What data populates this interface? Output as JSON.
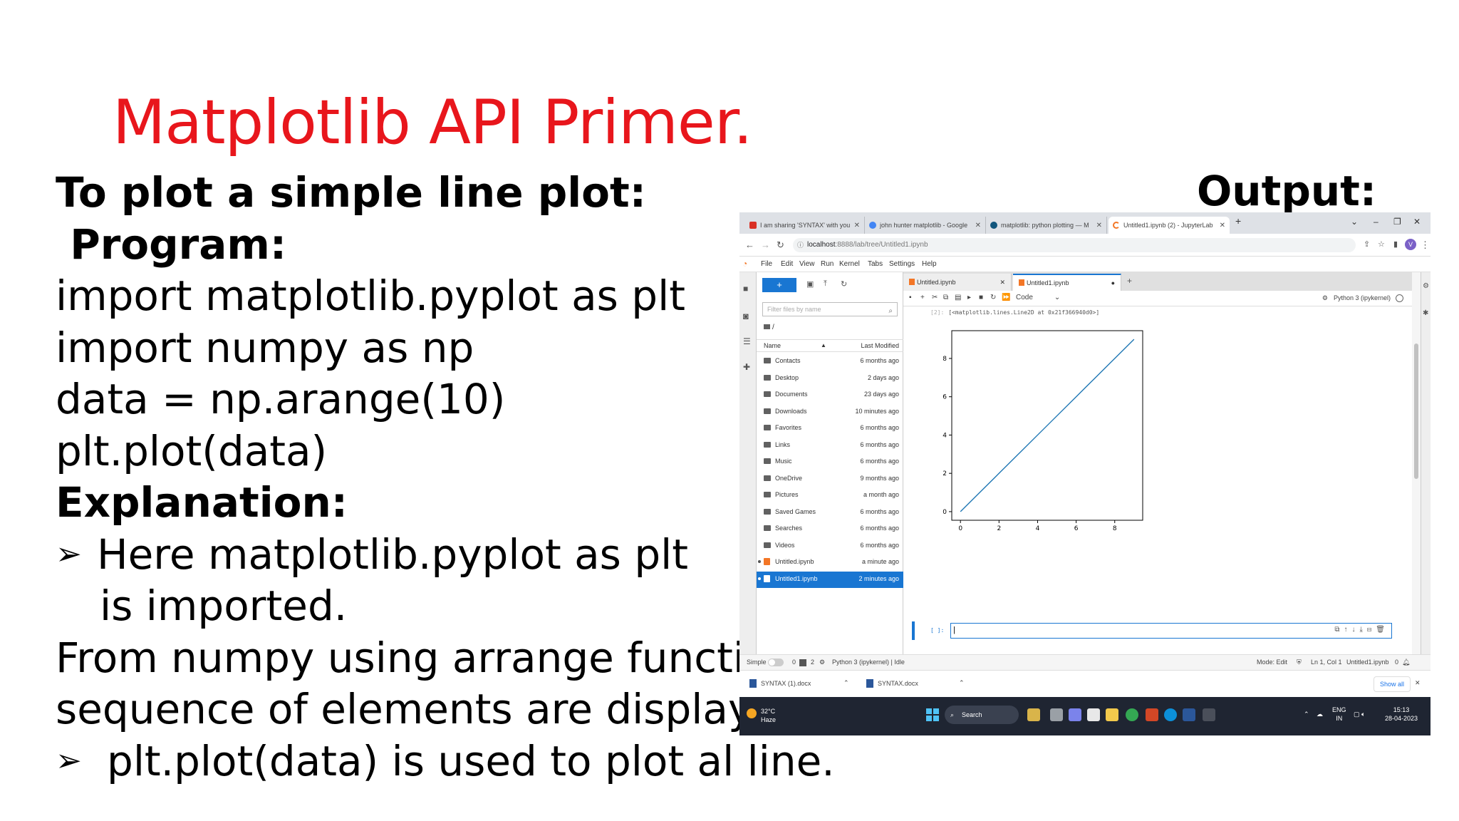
{
  "slide": {
    "title": "Matplotlib API Primer.",
    "lines": [
      "To plot a simple line plot:",
      " Program:",
      "import matplotlib.pyplot as plt",
      "import numpy as np",
      "data = np.arange(10)",
      "plt.plot(data)",
      "Explanation:",
      "Here matplotlib.pyplot as plt",
      "is imported.",
      "From numpy using arrange function",
      "sequence of elements are displayed.",
      "plt.plot(data) is used to plot al line."
    ],
    "bullet": "➢",
    "output_label": "Output:"
  },
  "browser": {
    "tabs": [
      {
        "label": "I am sharing 'SYNTAX' with you",
        "favicon": "gmail-icon",
        "color": "#d93025"
      },
      {
        "label": "john hunter matplotlib - Google",
        "favicon": "google-icon",
        "color": "#4285f4"
      },
      {
        "label": "matplotlib: python plotting — M",
        "favicon": "matplotlib-icon",
        "color": "#11557c"
      },
      {
        "label": "Untitled1.ipynb (2) - JupyterLab",
        "favicon": "jupyter-icon",
        "color": "#f37626"
      }
    ],
    "new_tab": "+",
    "url_host": "localhost",
    "url_path": ":8888/lab/tree/Untitled1.ipynb",
    "profile_initial": "V"
  },
  "jupyter": {
    "menu": [
      "File",
      "Edit",
      "View",
      "Run",
      "Kernel",
      "Tabs",
      "Settings",
      "Help"
    ],
    "filter_placeholder": "Filter files by name",
    "path": "/",
    "columns": {
      "name": "Name",
      "modified": "Last Modified"
    },
    "files": [
      {
        "name": "Contacts",
        "modified": "6 months ago",
        "type": "folder"
      },
      {
        "name": "Desktop",
        "modified": "2 days ago",
        "type": "folder"
      },
      {
        "name": "Documents",
        "modified": "23 days ago",
        "type": "folder"
      },
      {
        "name": "Downloads",
        "modified": "10 minutes ago",
        "type": "folder"
      },
      {
        "name": "Favorites",
        "modified": "6 months ago",
        "type": "folder"
      },
      {
        "name": "Links",
        "modified": "6 months ago",
        "type": "folder"
      },
      {
        "name": "Music",
        "modified": "6 months ago",
        "type": "folder"
      },
      {
        "name": "OneDrive",
        "modified": "9 months ago",
        "type": "folder"
      },
      {
        "name": "Pictures",
        "modified": "a month ago",
        "type": "folder"
      },
      {
        "name": "Saved Games",
        "modified": "6 months ago",
        "type": "folder"
      },
      {
        "name": "Searches",
        "modified": "6 months ago",
        "type": "folder"
      },
      {
        "name": "Videos",
        "modified": "6 months ago",
        "type": "folder"
      },
      {
        "name": "Untitled.ipynb",
        "modified": "a minute ago",
        "type": "notebook"
      },
      {
        "name": "Untitled1.ipynb",
        "modified": "2 minutes ago",
        "type": "notebook",
        "selected": true
      }
    ],
    "doc_tabs": [
      "Untitled.ipynb",
      "Untitled1.ipynb"
    ],
    "cell_type": "Code",
    "kernel": "Python 3 (ipykernel)",
    "output_prompt": "[2]:",
    "output_text": "[<matplotlib.lines.Line2D at 0x21f366940d0>]",
    "input_prompt": "[ ]:",
    "status": {
      "mode_label": "Simple",
      "counts": "0",
      "counts2": "2",
      "kernel_status": "Python 3 (ipykernel) | Idle",
      "edit_mode": "Mode: Edit",
      "cursor": "Ln 1, Col 1",
      "file": "Untitled1.ipynb",
      "notifications": "0"
    }
  },
  "chart_data": {
    "type": "line",
    "x": [
      0,
      1,
      2,
      3,
      4,
      5,
      6,
      7,
      8,
      9
    ],
    "y": [
      0,
      1,
      2,
      3,
      4,
      5,
      6,
      7,
      8,
      9
    ],
    "xticks": [
      0,
      2,
      4,
      6,
      8
    ],
    "yticks": [
      0,
      2,
      4,
      6,
      8
    ],
    "xlim": [
      -0.45,
      9.45
    ],
    "ylim": [
      -0.45,
      9.45
    ],
    "color": "#1f77b4",
    "grid": false
  },
  "downloads": {
    "items": [
      "SYNTAX (1).docx",
      "SYNTAX.docx"
    ],
    "show_all": "Show all"
  },
  "taskbar": {
    "temperature": "32°C",
    "weather": "Haze",
    "search": "Search",
    "lang1": "ENG",
    "lang2": "IN",
    "time": "15:13",
    "date": "28-04-2023"
  }
}
